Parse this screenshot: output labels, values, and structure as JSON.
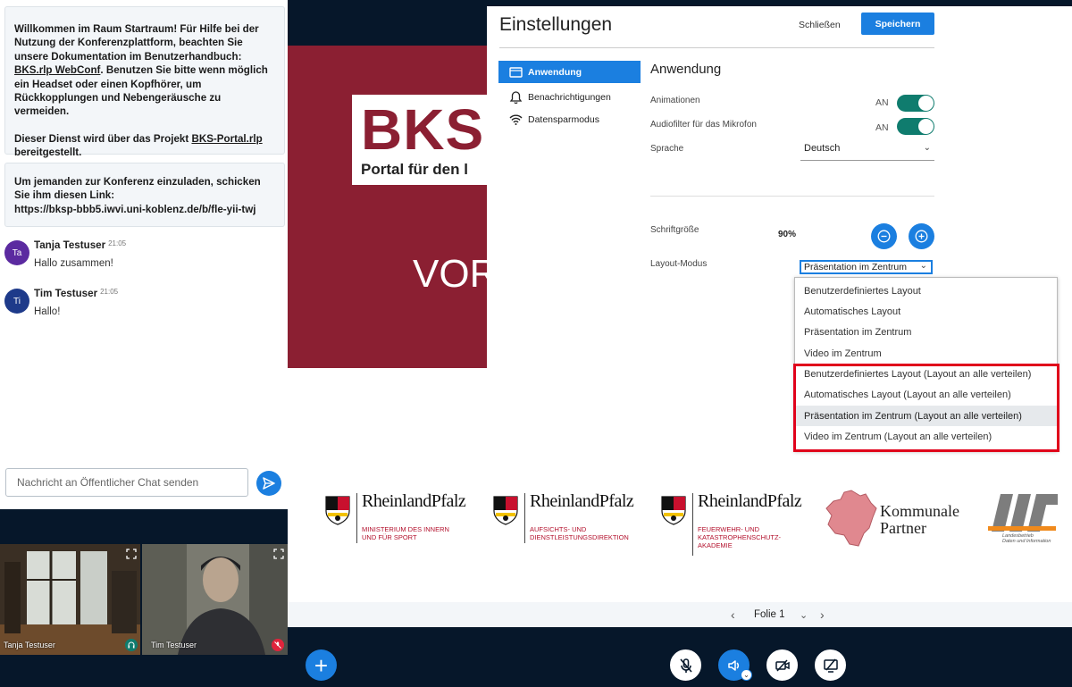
{
  "chat": {
    "welcome_pre": "Willkommen im Raum Startraum! Für Hilfe bei der Nutzung der Konferenzplattform, beachten Sie unsere Dokumentation im Benutzerhandbuch: ",
    "welcome_link": "BKS.rlp WebConf",
    "welcome_post": ". Benutzen Sie bitte wenn möglich ein Headset oder einen Kopfhörer, um Rückkopplungen und Nebengeräusche zu vermeiden.",
    "service_pre": "Dieser Dienst wird über das Projekt ",
    "service_link": "BKS-Portal.rlp",
    "service_post": " bereitgestellt.",
    "invite_text": "Um jemanden zur Konferenz einzuladen, schicken Sie ihm diesen Link:",
    "invite_link": "https://bksp-bbb5.iwvi.uni-koblenz.de/b/fle-yii-twj",
    "messages": [
      {
        "initials": "Ta",
        "name": "Tanja Testuser",
        "time": "21:05",
        "text": "Hallo zusammen!",
        "color": "#5b2aa0"
      },
      {
        "initials": "Ti",
        "name": "Tim Testuser",
        "time": "21:05",
        "text": "Hallo!",
        "color": "#1e3a8a"
      }
    ],
    "input_placeholder": "Nachricht an Öffentlicher Chat senden"
  },
  "webcams": [
    {
      "name": "Tanja Testuser",
      "badge_color": "#0f7c6e"
    },
    {
      "name": "Tim Testuser",
      "badge_color": "#e0243c"
    }
  ],
  "presentation": {
    "logo_big": "BKS",
    "logo_sub": "Portal für den l",
    "vor_text": "VOR",
    "logos": [
      {
        "word": "RheinlandPfalz",
        "sub": "MINISTERIUM DES INNERN\nUND FÜR SPORT"
      },
      {
        "word": "RheinlandPfalz",
        "sub": "AUFSICHTS- UND\nDIENSTLEISTUNGSDIREKTION"
      },
      {
        "word": "RheinlandPfalz",
        "sub": "FEUERWEHR- UND\nKATASTROPHENSCHUTZ-\nAKADEMIE"
      }
    ],
    "kommunale": "Kommunale\nPartner",
    "ldi_sub": "Landesbetrieb\nDaten und Information",
    "slide_label": "Folie 1"
  },
  "settings": {
    "title": "Einstellungen",
    "close_label": "Schließen",
    "save_label": "Speichern",
    "nav": [
      {
        "label": "Anwendung",
        "icon": "monitor-icon",
        "active": true
      },
      {
        "label": "Benachrichtigungen",
        "icon": "bell-icon",
        "active": false
      },
      {
        "label": "Datensparmodus",
        "icon": "wifi-icon",
        "active": false
      }
    ],
    "section_title": "Anwendung",
    "animations_label": "Animationen",
    "animations_state": "AN",
    "audiofilter_label": "Audiofilter für das Mikrofon",
    "audiofilter_state": "AN",
    "language_label": "Sprache",
    "language_value": "Deutsch",
    "fontsize_label": "Schriftgröße",
    "fontsize_value": "90%",
    "layout_label": "Layout-Modus",
    "layout_value": "Präsentation im Zentrum",
    "layout_options": [
      "Benutzerdefiniertes Layout",
      "Automatisches Layout",
      "Präsentation im Zentrum",
      "Video im Zentrum",
      "Benutzerdefiniertes Layout (Layout an alle verteilen)",
      "Automatisches Layout (Layout an alle verteilen)",
      "Präsentation im Zentrum (Layout an alle verteilen)",
      "Video im Zentrum (Layout an alle verteilen)"
    ],
    "highlighted_option_index": 6
  },
  "colors": {
    "accent": "#1b7fe0",
    "toggle_on": "#0f7c6e",
    "slide_red": "#8b1f32",
    "annotation_red": "#e0001b",
    "toolbar_bg": "#06172a"
  }
}
